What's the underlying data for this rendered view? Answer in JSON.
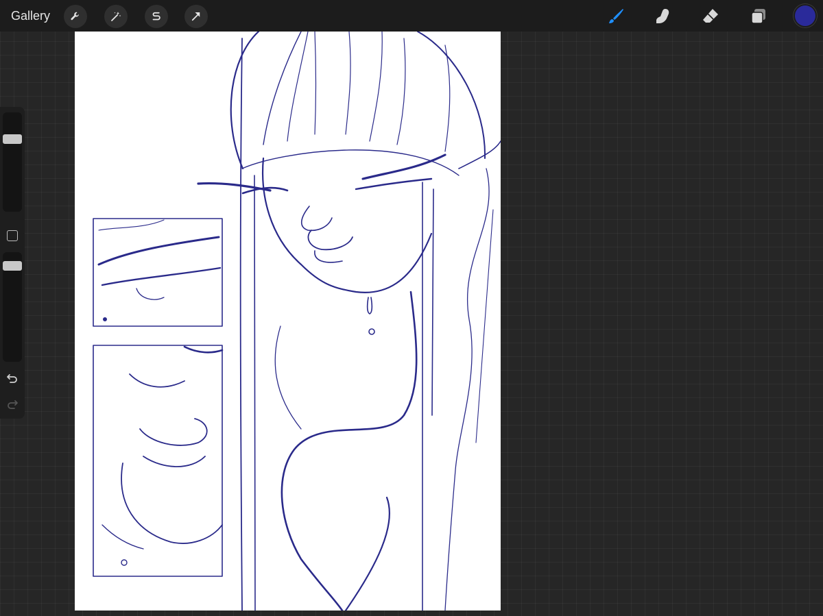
{
  "topbar": {
    "gallery_label": "Gallery",
    "tools_left": [
      {
        "name": "actions",
        "icon": "wrench-icon"
      },
      {
        "name": "adjustments",
        "icon": "magic-wand-icon"
      },
      {
        "name": "selection",
        "icon": "selection-s-icon"
      },
      {
        "name": "transform",
        "icon": "arrow-cursor-icon"
      }
    ],
    "tools_right": [
      {
        "name": "brush",
        "icon": "brush-icon",
        "active": true
      },
      {
        "name": "smudge",
        "icon": "smudge-finger-icon",
        "active": false
      },
      {
        "name": "eraser",
        "icon": "eraser-icon",
        "active": false
      },
      {
        "name": "layers",
        "icon": "layers-icon",
        "active": false
      }
    ],
    "active_color": "#2a2a9a",
    "accent_color": "#1f8fff"
  },
  "sidebar": {
    "brush_size_level": 0.2,
    "brush_opacity_level": 0.1,
    "modify_icon": "square-icon",
    "undo_icon": "undo-icon",
    "redo_icon": "redo-icon"
  },
  "canvas": {
    "background": "#ffffff",
    "ink_color": "#2a2a8a"
  }
}
